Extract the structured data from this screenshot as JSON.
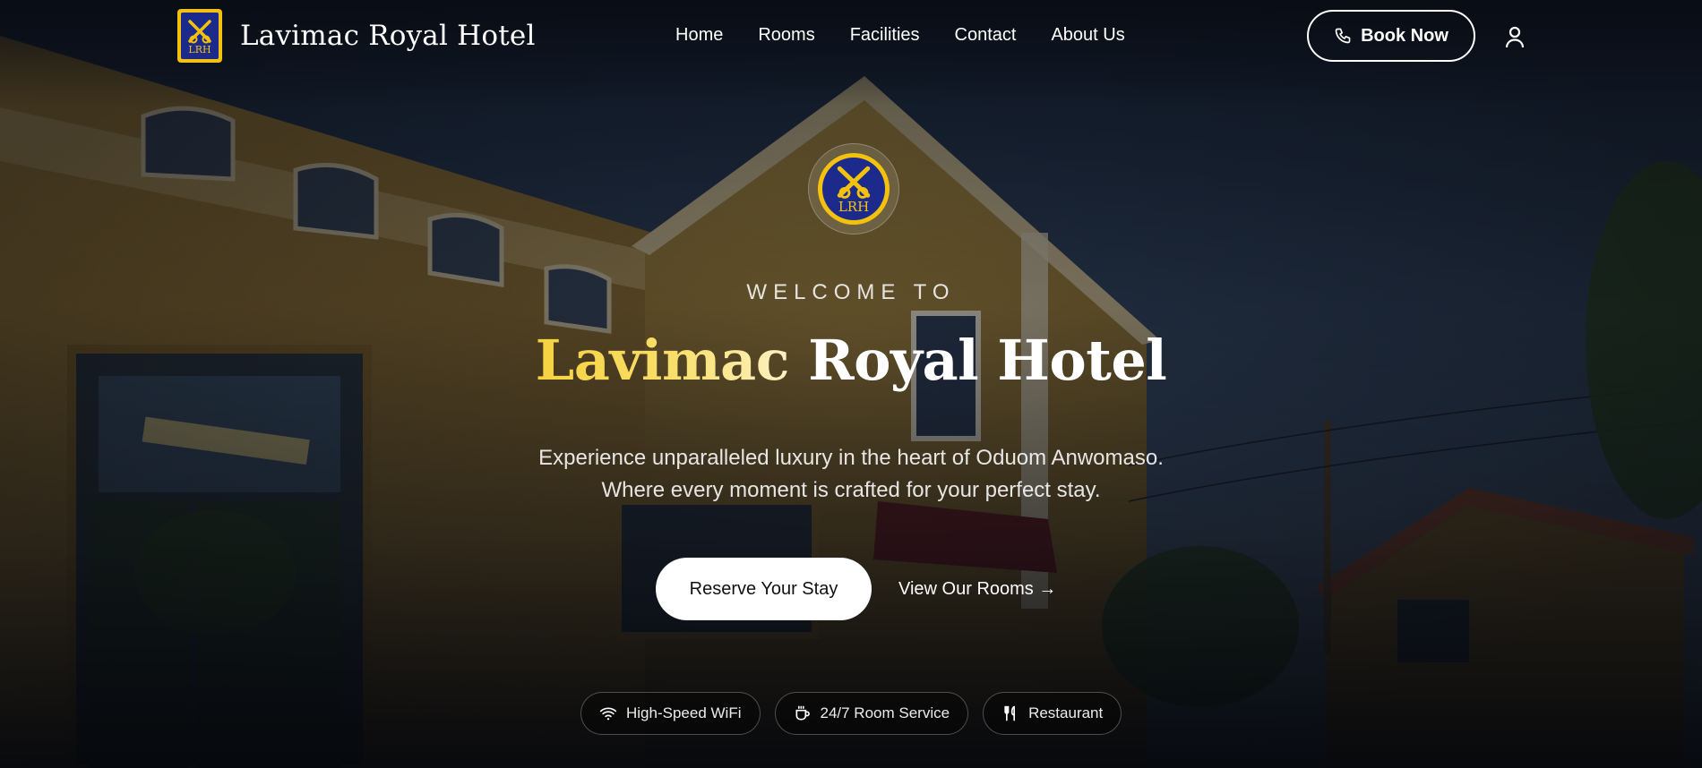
{
  "colors": {
    "gold": "#f4c20d",
    "royal_blue": "#1c2a8c",
    "button_white": "#ffffff"
  },
  "header": {
    "logo_text": "LRH",
    "brand_name": "Lavimac Royal Hotel",
    "nav": [
      {
        "label": "Home"
      },
      {
        "label": "Rooms"
      },
      {
        "label": "Facilities"
      },
      {
        "label": "Contact"
      },
      {
        "label": "About Us"
      }
    ],
    "book_label": "Book Now",
    "book_icon": "phone-icon",
    "account_icon": "user-icon"
  },
  "hero": {
    "emblem_text": "LRH",
    "eyebrow": "WELCOME TO",
    "title_first": "Lavimac",
    "title_rest": "Royal Hotel",
    "tagline_line1": "Experience unparalleled luxury in the heart of Oduom Anwomaso.",
    "tagline_line2": "Where every moment is crafted for your perfect stay.",
    "primary_cta": "Reserve Your Stay",
    "secondary_cta": "View Our Rooms →",
    "features": [
      {
        "label": "High-Speed WiFi",
        "icon": "wifi-icon"
      },
      {
        "label": "24/7 Room Service",
        "icon": "coffee-cup-icon"
      },
      {
        "label": "Restaurant",
        "icon": "fork-knife-icon"
      }
    ]
  }
}
